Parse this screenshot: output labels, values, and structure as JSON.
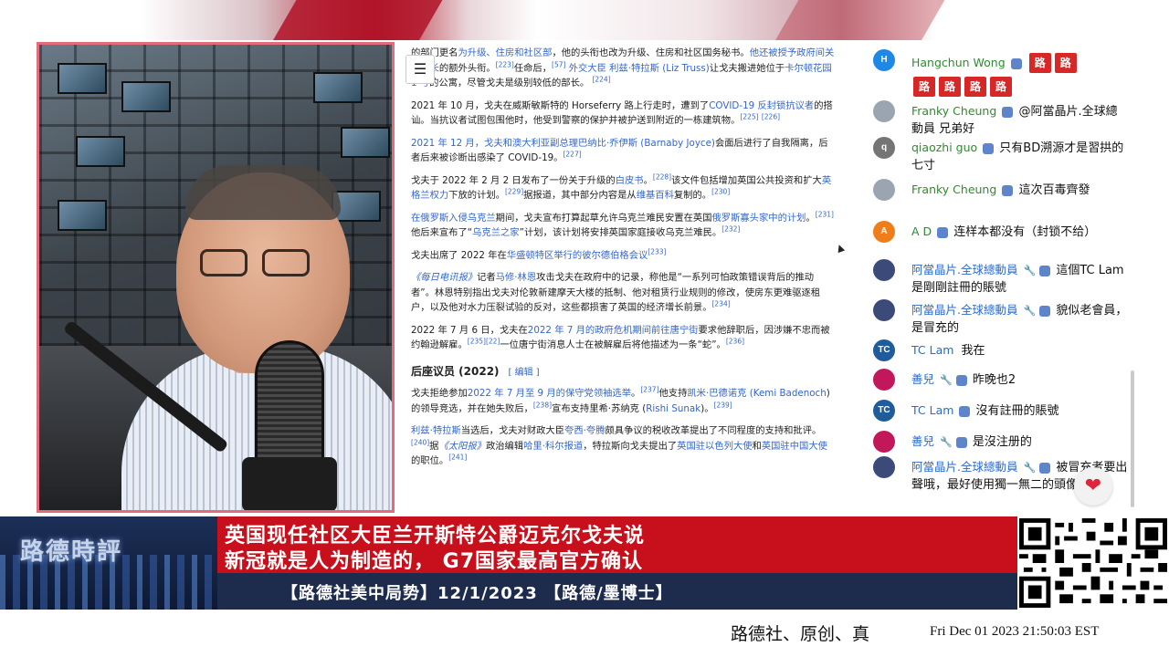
{
  "wiki": {
    "toc_icon": "☰",
    "para1": {
      "t1": "的部门更名",
      "l1": "为升级、住房和社区部",
      "t2": "，他的头衔也改为升级、住房和社区国务秘书。",
      "l2": "他还被授予政府间关系部长",
      "t3": "的额外头衔。",
      "s1": "[223]",
      "t4": "任命后，",
      "s2": "[57]",
      "l3": "外交大臣 利兹·特拉斯 (Liz Truss)",
      "t5": "让戈夫搬进她位于",
      "l4": "卡尔顿花园 1 号",
      "t6": "的公寓，尽管戈夫是级别较低的部长。",
      "s3": "[224]"
    },
    "para2": {
      "t1": "2021 年 10 月，戈夫在威斯敏斯特的 Horseferry 路上行走时，遭到了",
      "l1": "COVID-19 反封锁抗议者",
      "t2": "的搭讪。当抗议者试图包围他时，他受到警察的保护并被护送到附近的一栋建筑物。",
      "s1": "[225]",
      "s2": "[226]"
    },
    "para3": {
      "l1": "2021 年 12 月，戈夫和澳大利亚副总理巴纳比·乔伊斯 (Barnaby Joyce)",
      "t1": "会面后进行了自我隔离，后者后来被诊断出感染了 COVID-19。",
      "s1": "[227]"
    },
    "para4": {
      "t1": "戈夫于 2022 年 2 月 2 日发布了一份关于升级的",
      "l1": "白皮书",
      "t2": "。",
      "s1": "[228]",
      "t3": "该文件包括增加英国公共投资和扩大",
      "l2": "英格兰权力",
      "t4": "下放的计划。",
      "s2": "[229]",
      "t5": "据报道，其中部分内容是从",
      "l3": "维基百科",
      "t6": "复制的。",
      "s3": "[230]"
    },
    "para5": {
      "l1": "在俄罗斯入侵乌克兰",
      "t1": "期间，戈夫宣布打算起草允许乌克兰难民安置在英国",
      "l2": "俄罗斯寡头家中的计划",
      "t2": "。",
      "s1": "[231]",
      "t3": "他后来宣布了“",
      "l3": "乌克兰之家",
      "t4": "”计划，该计划将安排英国家庭接收乌克兰难民。",
      "s2": "[232]"
    },
    "para6": {
      "t1": "戈夫出席了 2022 年在",
      "l1": "华盛顿特区举行的彼尔德伯格会议",
      "s1": "[233]"
    },
    "para7": {
      "l1": "《每日电讯报》",
      "t1": "记者",
      "l2": "马修·林恩",
      "t2": "攻击戈夫在政府中的记录，称他是“一系列可怕政策错误背后的推动者”。林恩特别指出戈夫对伦敦新建摩天大楼的抵制、他对租赁行业规则的修改，使房东更难驱逐租户，以及他对水力压裂试验的反对，这些都损害了英国的经济增长前景。",
      "s1": "[234]"
    },
    "para8": {
      "t1": "2022 年 7 月 6 日，戈夫在",
      "l1": "2022 年 7 月的政府危机期间前往唐宁街",
      "t2": "要求他辞职后，因涉嫌不忠而被约翰逊解雇。",
      "s1": "[235]",
      "s2": "[22]",
      "t3": "一位唐宁街消息人士在被解雇后将他描述为一条“蛇”。",
      "s3": "[236]"
    },
    "section_heading": "后座议员 (2022)",
    "section_edit": "[ 编辑 ]",
    "para9": {
      "t1": "戈夫拒绝参加",
      "l1": "2022 年 7 月至 9 月的保守党领袖选举",
      "t2": "。",
      "s1": "[237]",
      "t3": "他支持",
      "l2": "凯米·巴德诺克 (Kemi Badenoch",
      "t4": ") 的领导竞选，并在她失败后，",
      "s2": "[238]",
      "t5": "宣布支持里希·苏纳克 (",
      "l3": "Rishi Sunak",
      "t6": ")。",
      "s3": "[239]"
    },
    "para10": {
      "l1": "利兹·特拉斯",
      "t1": "当选后，戈夫对财政大臣",
      "l2": "夸西·夸腾",
      "t2": "颇具争议的税收改革提出了不同程度的支持和批评。",
      "s1": "[240]",
      "t3": "据",
      "l3": "《太阳报》",
      "t4": "政治编辑",
      "l4": "哈里·科尔报道",
      "t5": "，特拉斯向戈夫提出了",
      "l5": "英国驻以色列大使",
      "t6": "和",
      "l6": "英国驻中国大使",
      "t7": "的职位。",
      "s2": "[241]"
    }
  },
  "chat": {
    "messages": [
      {
        "initials": "H",
        "avatar_color": "#1e88e5",
        "author": "Hangchun Wong",
        "text": ""
      },
      {
        "initials": "",
        "avatar_color": "#9aa5b1",
        "author": "Franky Cheung",
        "text": "@阿當晶片.全球總動員 兄弟好"
      },
      {
        "initials": "q",
        "avatar_color": "#757575",
        "author": "qiaozhi guo",
        "text": "只有BD溯源才是習拱的七寸"
      },
      {
        "initials": "",
        "avatar_color": "#9aa5b1",
        "author": "Franky Cheung",
        "text": "這次百毒齊發"
      },
      {
        "initials": "A",
        "avatar_color": "#ef7d1a",
        "author": "A D",
        "text": "连样本都没有（封锁不给）"
      },
      {
        "initials": "",
        "avatar_color": "#3b4a78",
        "author": "阿當晶片.全球總動員",
        "text": "這個TC Lam是剛剛註冊的賬號"
      },
      {
        "initials": "",
        "avatar_color": "#3b4a78",
        "author": "阿當晶片.全球總動員",
        "text": "貌似老會員，是冒充的"
      },
      {
        "initials": "TC",
        "avatar_color": "#1f5c99",
        "author": "TC Lam",
        "text": "我在"
      },
      {
        "initials": "",
        "avatar_color": "#c2185b",
        "author": "善兒",
        "text": "昨晚也2"
      },
      {
        "initials": "TC",
        "avatar_color": "#1f5c99",
        "author": "TC Lam",
        "text": "沒有註冊的賬號"
      },
      {
        "initials": "",
        "avatar_color": "#c2185b",
        "author": "善兒",
        "text": "是沒注册的"
      },
      {
        "initials": "",
        "avatar_color": "#3b4a78",
        "author": "阿當晶片.全球總動員",
        "text": "被冒充者要出聲哦，最好使用獨一無二的頭像"
      }
    ],
    "lu_emoji": "路",
    "heart_icon": "❤"
  },
  "lower_third": {
    "logo_text": "路德時評",
    "headline_line1": "英国现任社区大臣兰开斯特公爵迈克尔戈夫说",
    "headline_line2": "新冠就是人为制造的， G7国家最高官方确认",
    "subline": "【路德社美中局势】12/1/2023 【路德/墨博士】"
  },
  "footer": {
    "brand": "路德社、原创、真",
    "datetime": "Fri Dec 01 2023 21:50:03 EST"
  }
}
